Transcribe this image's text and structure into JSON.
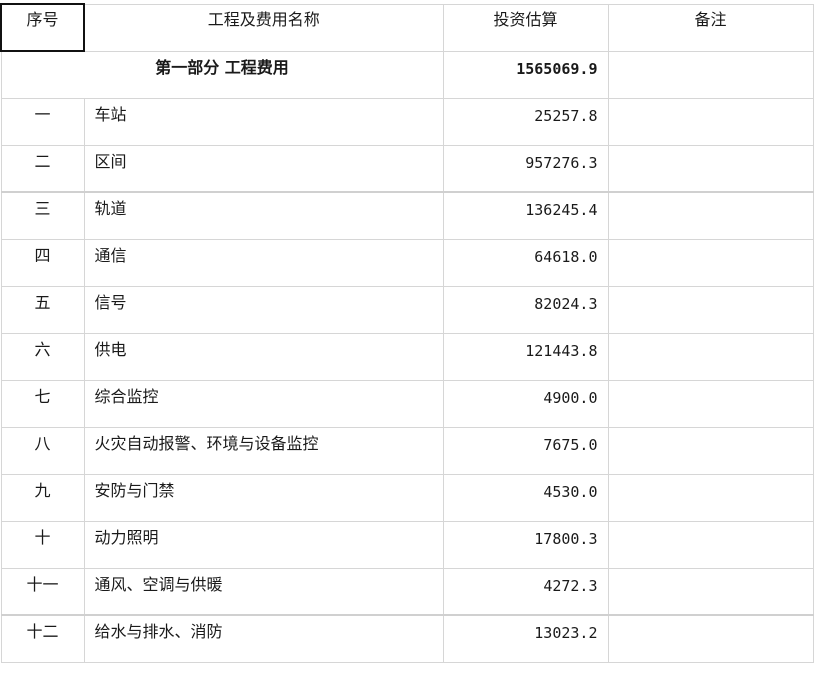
{
  "headers": {
    "seq": "序号",
    "name": "工程及费用名称",
    "amount": "投资估算",
    "note": "备注"
  },
  "section": {
    "title": "第一部分  工程费用",
    "amount": "1565069.9"
  },
  "rows": [
    {
      "seq": "一",
      "name": "车站",
      "amount": "25257.8"
    },
    {
      "seq": "二",
      "name": "区间",
      "amount": "957276.3"
    },
    {
      "seq": "三",
      "name": "轨道",
      "amount": "136245.4"
    },
    {
      "seq": "四",
      "name": "通信",
      "amount": "64618.0"
    },
    {
      "seq": "五",
      "name": "信号",
      "amount": "82024.3"
    },
    {
      "seq": "六",
      "name": "供电",
      "amount": "121443.8"
    },
    {
      "seq": "七",
      "name": "综合监控",
      "amount": "4900.0"
    },
    {
      "seq": "八",
      "name": "火灾自动报警、环境与设备监控",
      "amount": "7675.0"
    },
    {
      "seq": "九",
      "name": "安防与门禁",
      "amount": "4530.0"
    },
    {
      "seq": "十",
      "name": "动力照明",
      "amount": "17800.3"
    },
    {
      "seq": "十一",
      "name": "通风、空调与供暖",
      "amount": "4272.3"
    },
    {
      "seq": "十二",
      "name": "给水与排水、消防",
      "amount": "13023.2"
    }
  ]
}
